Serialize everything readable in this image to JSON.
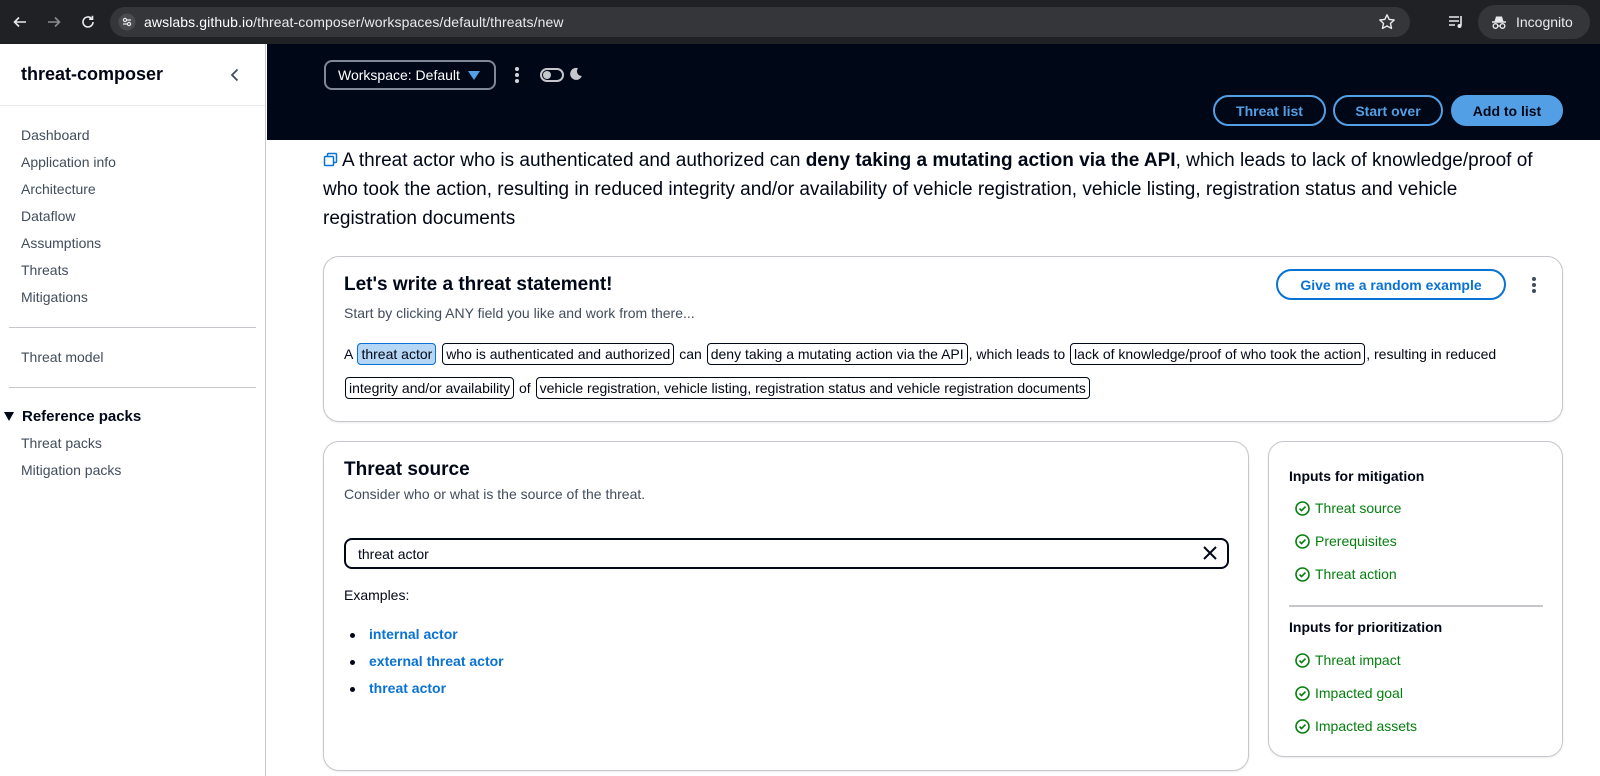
{
  "browser": {
    "url_host": "awslabs.github.io",
    "url_path": "/threat-composer/workspaces/default/threats/new",
    "profile_label": "Incognito"
  },
  "sidebar": {
    "title": "threat-composer",
    "nav_items": [
      "Dashboard",
      "Application info",
      "Architecture",
      "Dataflow",
      "Assumptions",
      "Threats",
      "Mitigations"
    ],
    "threat_model": "Threat model",
    "reference_section": "Reference packs",
    "reference_items": [
      "Threat packs",
      "Mitigation packs"
    ]
  },
  "header": {
    "workspace_label": "Workspace: Default",
    "buttons": {
      "threat_list": "Threat list",
      "start_over": "Start over",
      "add_to_list": "Add to list"
    }
  },
  "statement": {
    "prefix": "A threat actor who is authenticated and authorized can ",
    "bold": "deny taking a mutating action via the API",
    "suffix": ", which leads to lack of knowledge/proof of who took the action, resulting in reduced integrity and/or availability of vehicle registration, vehicle listing, registration status and vehicle registration documents"
  },
  "writer": {
    "title": "Let's write a threat statement!",
    "description": "Start by clicking ANY field you like and work from there...",
    "random_button": "Give me a random example",
    "text_a": "A",
    "token_source": "threat actor",
    "token_prerequisites": "who is authenticated and authorized",
    "text_can": "can",
    "token_action": "deny taking a mutating action via the API",
    "text_leads": ", which leads to",
    "token_impact": "lack of knowledge/proof of who took the action",
    "text_resulting": ", resulting in reduced",
    "token_goal": "integrity and/or availability",
    "text_of": "of",
    "token_assets": "vehicle registration, vehicle listing, registration status and vehicle registration documents"
  },
  "threat_source": {
    "title": "Threat source",
    "description": "Consider who or what is the source of the threat.",
    "input_value": "threat actor",
    "examples_label": "Examples:",
    "examples": [
      "internal actor",
      "external threat actor",
      "threat actor"
    ]
  },
  "inputs_panel": {
    "mitigation_heading": "Inputs for mitigation",
    "mitigation_items": [
      "Threat source",
      "Prerequisites",
      "Threat action"
    ],
    "prioritization_heading": "Inputs for prioritization",
    "prioritization_items": [
      "Threat impact",
      "Impacted goal",
      "Impacted assets"
    ]
  },
  "colors": {
    "header_bg": "#000716",
    "accent_blue": "#0972d3",
    "header_blue": "#539fe5",
    "success_green": "#037f0c"
  }
}
